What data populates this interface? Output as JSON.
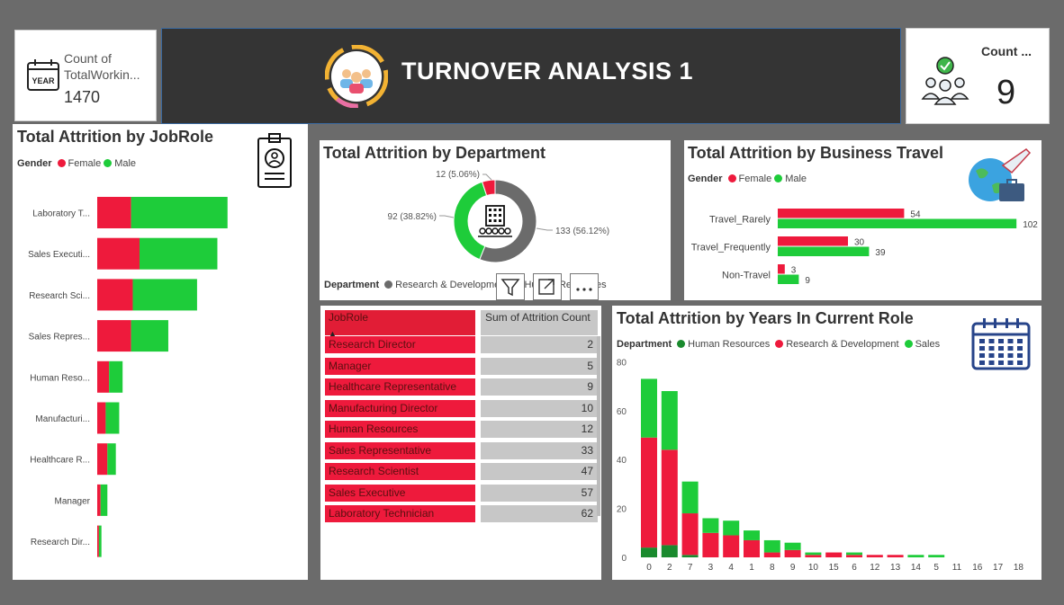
{
  "kpis": {
    "total_working": {
      "label": "Count of TotalWorkin...",
      "value": "1470"
    },
    "count": {
      "label": "Count ...",
      "value": "9"
    }
  },
  "header": {
    "title": "TURNOVER ANALYSIS 1"
  },
  "icons": {
    "calendar_year": "YEAR",
    "header_logo": "team-circle-icon",
    "kpi_people": "people-check-icon",
    "id_badge": "id-badge-icon",
    "building": "building-icon",
    "travel": "globe-plane-icon",
    "calendar": "calendar-icon"
  },
  "colors": {
    "female": "#ee1a3c",
    "male": "#1ecc3a",
    "hr": "#1a8a2e",
    "rd": "#ee1a3c",
    "sales": "#1ecc3a",
    "gray": "#6b6b6b"
  },
  "visual_header": {
    "buttons": [
      "filter-icon",
      "focus-mode-icon",
      "more-options-icon"
    ]
  },
  "chart_data": [
    {
      "id": "jobrole",
      "type": "bar",
      "orientation": "horizontal",
      "stacked": true,
      "title": "Total Attrition by JobRole",
      "legend_title": "Gender",
      "categories": [
        "Laboratory T...",
        "Sales Executi...",
        "Research Sci...",
        "Sales Repres...",
        "Human Reso...",
        "Manufacturi...",
        "Healthcare R...",
        "Manager",
        "Research Dir..."
      ],
      "series": [
        {
          "name": "Female",
          "values": [
            20,
            25,
            21,
            20,
            7,
            5,
            6,
            2,
            1
          ]
        },
        {
          "name": "Male",
          "values": [
            57,
            46,
            38,
            22,
            8,
            8,
            5,
            4,
            1.5
          ]
        }
      ]
    },
    {
      "id": "department",
      "type": "pie",
      "donut": true,
      "title": "Total Attrition by Department",
      "legend_title": "Department",
      "legend_entries": [
        "Research & Development",
        "Human Resources"
      ],
      "slices": [
        {
          "name": "Research & Development",
          "value": 133,
          "label": "133 (56.12%)"
        },
        {
          "name": "Sales",
          "value": 92,
          "label": "92 (38.82%)"
        },
        {
          "name": "Human Resources",
          "value": 12,
          "label": "12 (5.06%)"
        }
      ]
    },
    {
      "id": "travel",
      "type": "bar",
      "orientation": "horizontal",
      "title": "Total Attrition by Business Travel",
      "legend_title": "Gender",
      "categories": [
        "Travel_Rarely",
        "Travel_Frequently",
        "Non-Travel"
      ],
      "series": [
        {
          "name": "Female",
          "values": [
            54,
            30,
            3
          ]
        },
        {
          "name": "Male",
          "values": [
            102,
            39,
            9
          ]
        }
      ]
    },
    {
      "id": "jobrole_table",
      "type": "table",
      "columns": [
        "JobRole",
        "Sum of Attrition Count"
      ],
      "rows": [
        [
          "Research Director",
          "2"
        ],
        [
          "Manager",
          "5"
        ],
        [
          "Healthcare Representative",
          "9"
        ],
        [
          "Manufacturing Director",
          "10"
        ],
        [
          "Human Resources",
          "12"
        ],
        [
          "Sales Representative",
          "33"
        ],
        [
          "Research Scientist",
          "47"
        ],
        [
          "Sales Executive",
          "57"
        ],
        [
          "Laboratory Technician",
          "62"
        ]
      ]
    },
    {
      "id": "years",
      "type": "bar",
      "stacked": true,
      "title": "Total Attrition by Years In Current Role",
      "legend_title": "Department",
      "categories": [
        "0",
        "2",
        "7",
        "3",
        "4",
        "1",
        "8",
        "9",
        "10",
        "15",
        "6",
        "12",
        "13",
        "14",
        "5",
        "11",
        "16",
        "17",
        "18"
      ],
      "ylim": [
        0,
        80
      ],
      "yticks": [
        0,
        20,
        40,
        60,
        80
      ],
      "series": [
        {
          "name": "Human Resources",
          "values": [
            4,
            5,
            1,
            0,
            0,
            0,
            0,
            0,
            0,
            0,
            0,
            0,
            0,
            0,
            0,
            0,
            0,
            0,
            0
          ]
        },
        {
          "name": "Research & Development",
          "values": [
            45,
            39,
            17,
            10,
            9,
            7,
            2,
            3,
            1,
            2,
            1,
            1,
            1,
            0,
            0,
            0,
            0,
            0,
            0
          ]
        },
        {
          "name": "Sales",
          "values": [
            24,
            24,
            13,
            6,
            6,
            4,
            5,
            3,
            1,
            0,
            1,
            0,
            0,
            1,
            1,
            0,
            0,
            0,
            0
          ]
        }
      ]
    }
  ]
}
